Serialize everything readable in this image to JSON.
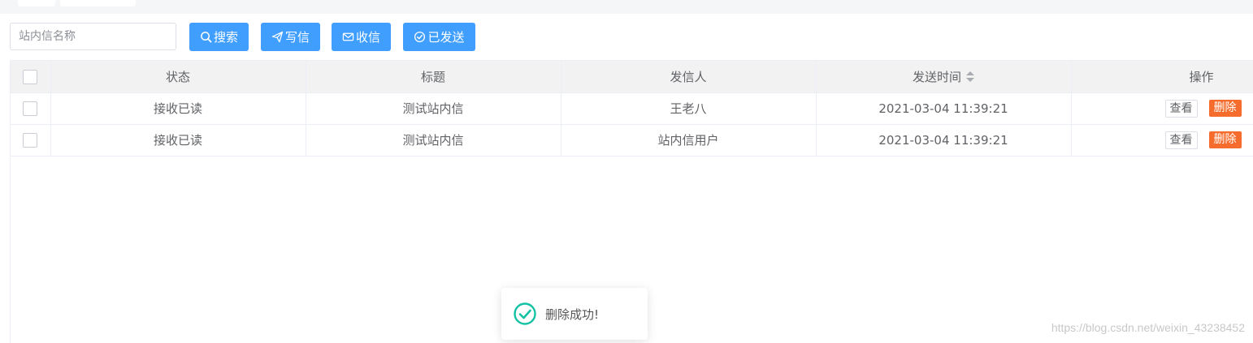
{
  "toolbar": {
    "search_placeholder": "站内信名称",
    "search_label": "搜索",
    "write_label": "写信",
    "inbox_label": "收信",
    "sent_label": "已发送"
  },
  "table": {
    "columns": [
      "状态",
      "标题",
      "发信人",
      "发送时间",
      "操作"
    ],
    "rows": [
      {
        "status": "接收已读",
        "title": "测试站内信",
        "sender": "王老八",
        "time": "2021-03-04 11:39:21",
        "view": "查看",
        "delete": "删除"
      },
      {
        "status": "接收已读",
        "title": "测试站内信",
        "sender": "站内信用户",
        "time": "2021-03-04 11:39:21",
        "view": "查看",
        "delete": "删除"
      }
    ]
  },
  "toast": {
    "message": "删除成功!"
  },
  "watermark": "https://blog.csdn.net/weixin_43238452",
  "colors": {
    "primary": "#409eff",
    "danger": "#f56c2c",
    "success": "#13c2a3"
  }
}
